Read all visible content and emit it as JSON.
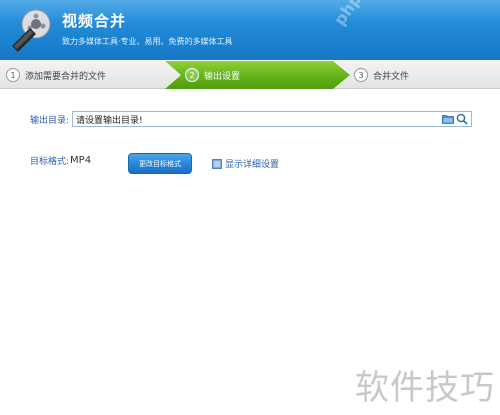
{
  "header": {
    "title": "视频合并",
    "subtitle": "致力多媒体工具·专业、易用、免费的多媒体工具",
    "watermark": "php.cn"
  },
  "steps": [
    {
      "number": "1",
      "label": "添加需要合并的文件",
      "active": false
    },
    {
      "number": "2",
      "label": "输出设置",
      "active": true
    },
    {
      "number": "3",
      "label": "合并文件",
      "active": false
    }
  ],
  "output": {
    "label": "输出目录:",
    "placeholder": "请设置输出目录!"
  },
  "format": {
    "label": "目标格式:",
    "value": "MP4",
    "change_button": "更改目标格式",
    "details_link": "显示详细设置"
  },
  "watermark_bottom": "软件技巧",
  "colors": {
    "header_blue": "#1f86d4",
    "step_active_green": "#67b51b",
    "link_blue": "#2a5fb0"
  }
}
